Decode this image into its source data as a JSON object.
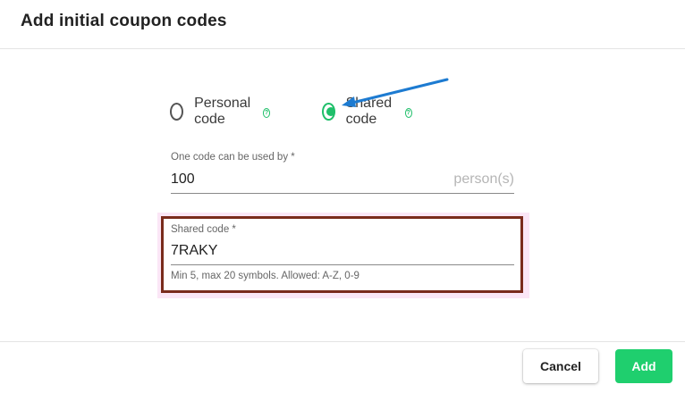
{
  "dialog": {
    "title": "Add initial coupon codes"
  },
  "code_type": {
    "options": [
      {
        "label": "Personal code",
        "checked": false
      },
      {
        "label": "Shared code",
        "checked": true
      }
    ],
    "help_icon": "question-icon"
  },
  "usage_field": {
    "label": "One code can be used by *",
    "value": "100",
    "suffix": "person(s)"
  },
  "shared_code_field": {
    "label": "Shared code *",
    "value": "7RAKY",
    "helper": "Min 5, max 20 symbols. Allowed: A-Z, 0-9"
  },
  "buttons": {
    "cancel": "Cancel",
    "add": "Add"
  },
  "colors": {
    "accent": "#1fcf6e",
    "highlight_border": "#7a2b1c",
    "highlight_bg": "#fbe6f6",
    "annotation_arrow": "#1d7bd1"
  }
}
